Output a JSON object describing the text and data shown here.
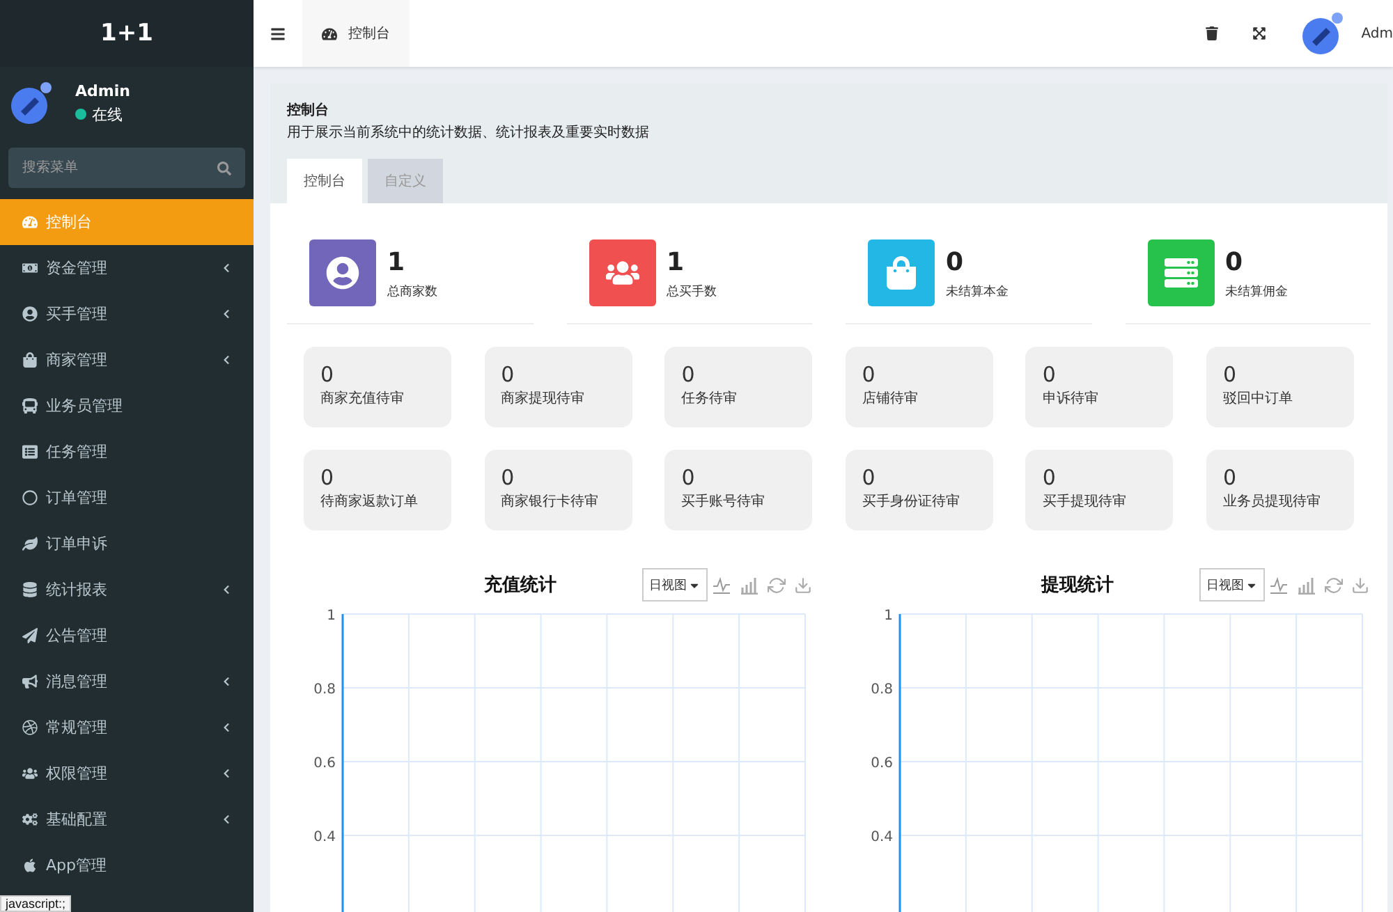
{
  "sidebar": {
    "brand": "1+1",
    "user": {
      "name": "Admin",
      "status": "在线"
    },
    "search": {
      "placeholder": "搜索菜单"
    },
    "items": [
      {
        "label": "控制台",
        "selected": true,
        "expandable": false
      },
      {
        "label": "资金管理",
        "selected": false,
        "expandable": true
      },
      {
        "label": "买手管理",
        "selected": false,
        "expandable": true
      },
      {
        "label": "商家管理",
        "selected": false,
        "expandable": true
      },
      {
        "label": "业务员管理",
        "selected": false,
        "expandable": false
      },
      {
        "label": "任务管理",
        "selected": false,
        "expandable": false
      },
      {
        "label": "订单管理",
        "selected": false,
        "expandable": false
      },
      {
        "label": "订单申诉",
        "selected": false,
        "expandable": false
      },
      {
        "label": "统计报表",
        "selected": false,
        "expandable": true
      },
      {
        "label": "公告管理",
        "selected": false,
        "expandable": false
      },
      {
        "label": "消息管理",
        "selected": false,
        "expandable": true
      },
      {
        "label": "常规管理",
        "selected": false,
        "expandable": true
      },
      {
        "label": "权限管理",
        "selected": false,
        "expandable": true
      },
      {
        "label": "基础配置",
        "selected": false,
        "expandable": true
      },
      {
        "label": "App管理",
        "selected": false,
        "expandable": false
      }
    ]
  },
  "header": {
    "tab": "控制台",
    "user": "Adm"
  },
  "panel": {
    "title": "控制台",
    "description": "用于展示当前系统中的统计数据、统计报表及重要实时数据",
    "tabs": [
      {
        "label": "控制台",
        "selected": true
      },
      {
        "label": "自定义",
        "selected": false
      }
    ]
  },
  "stats": [
    {
      "value": "1",
      "label": "总商家数",
      "color": "#7266ba"
    },
    {
      "value": "1",
      "label": "总买手数",
      "color": "#f05050"
    },
    {
      "value": "0",
      "label": "未结算本金",
      "color": "#23b7e5"
    },
    {
      "value": "0",
      "label": "未结算佣金",
      "color": "#27c24c"
    }
  ],
  "counters": [
    {
      "value": "0",
      "label": "商家充值待审"
    },
    {
      "value": "0",
      "label": "商家提现待审"
    },
    {
      "value": "0",
      "label": "任务待审"
    },
    {
      "value": "0",
      "label": "店铺待审"
    },
    {
      "value": "0",
      "label": "申诉待审"
    },
    {
      "value": "0",
      "label": "驳回中订单"
    },
    {
      "value": "0",
      "label": "待商家返款订单"
    },
    {
      "value": "0",
      "label": "商家银行卡待审"
    },
    {
      "value": "0",
      "label": "买手账号待审"
    },
    {
      "value": "0",
      "label": "买手身份证待审"
    },
    {
      "value": "0",
      "label": "买手提现待审"
    },
    {
      "value": "0",
      "label": "业务员提现待审"
    }
  ],
  "charts": [
    {
      "view_select": "日视图",
      "chart_data": {
        "type": "line",
        "title": "充值统计",
        "grid": true,
        "categories": [
          null,
          null,
          null,
          null,
          null,
          null,
          null,
          null
        ],
        "series": [
          {
            "values": [
              null,
              null,
              null,
              null,
              null,
              null,
              null,
              null
            ]
          }
        ],
        "ylim": [
          0,
          1
        ],
        "yticks": [
          {
            "value": 0.4,
            "label": "0.4"
          },
          {
            "value": 0.6,
            "label": "0.6"
          },
          {
            "value": 0.8,
            "label": "0.8"
          },
          {
            "value": 1,
            "label": "1"
          }
        ]
      }
    },
    {
      "view_select": "日视图",
      "chart_data": {
        "type": "line",
        "title": "提现统计",
        "grid": true,
        "categories": [
          null,
          null,
          null,
          null,
          null,
          null,
          null,
          null
        ],
        "series": [
          {
            "values": [
              null,
              null,
              null,
              null,
              null,
              null,
              null,
              null
            ]
          }
        ],
        "ylim": [
          0,
          1
        ],
        "yticks": [
          {
            "value": 0.4,
            "label": "0.4"
          },
          {
            "value": 0.6,
            "label": "0.6"
          },
          {
            "value": 0.8,
            "label": "0.8"
          },
          {
            "value": 1,
            "label": "1"
          }
        ]
      }
    }
  ],
  "browser_status": "javascript:;"
}
